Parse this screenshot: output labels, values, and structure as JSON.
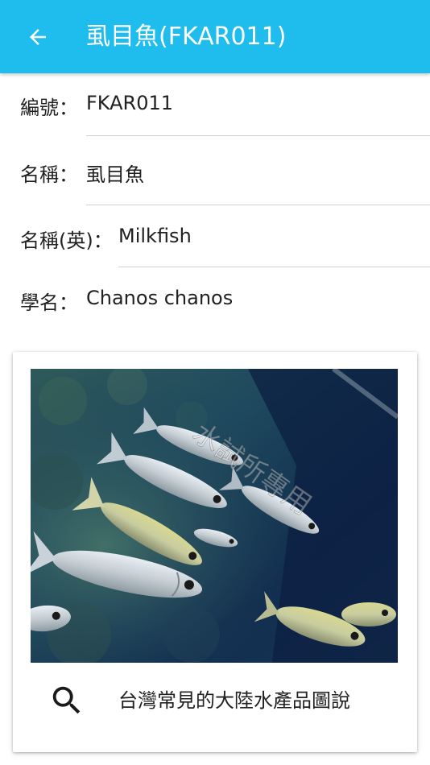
{
  "appbar": {
    "title": "虱目魚(FKAR011)",
    "back_icon": "arrow-back-icon",
    "color": "#1ebdee"
  },
  "fields": {
    "code": {
      "label": "編號：",
      "value": "FKAR011"
    },
    "name": {
      "label": "名稱：",
      "value": "虱目魚"
    },
    "name_en": {
      "label": "名稱(英)：",
      "value": "Milkfish"
    },
    "scientific": {
      "label": "學名：",
      "value": "Chanos chanos"
    }
  },
  "card": {
    "photo_watermark": "水試所專用",
    "search_icon": "search-icon",
    "caption": "台灣常見的大陸水產品圖說"
  }
}
